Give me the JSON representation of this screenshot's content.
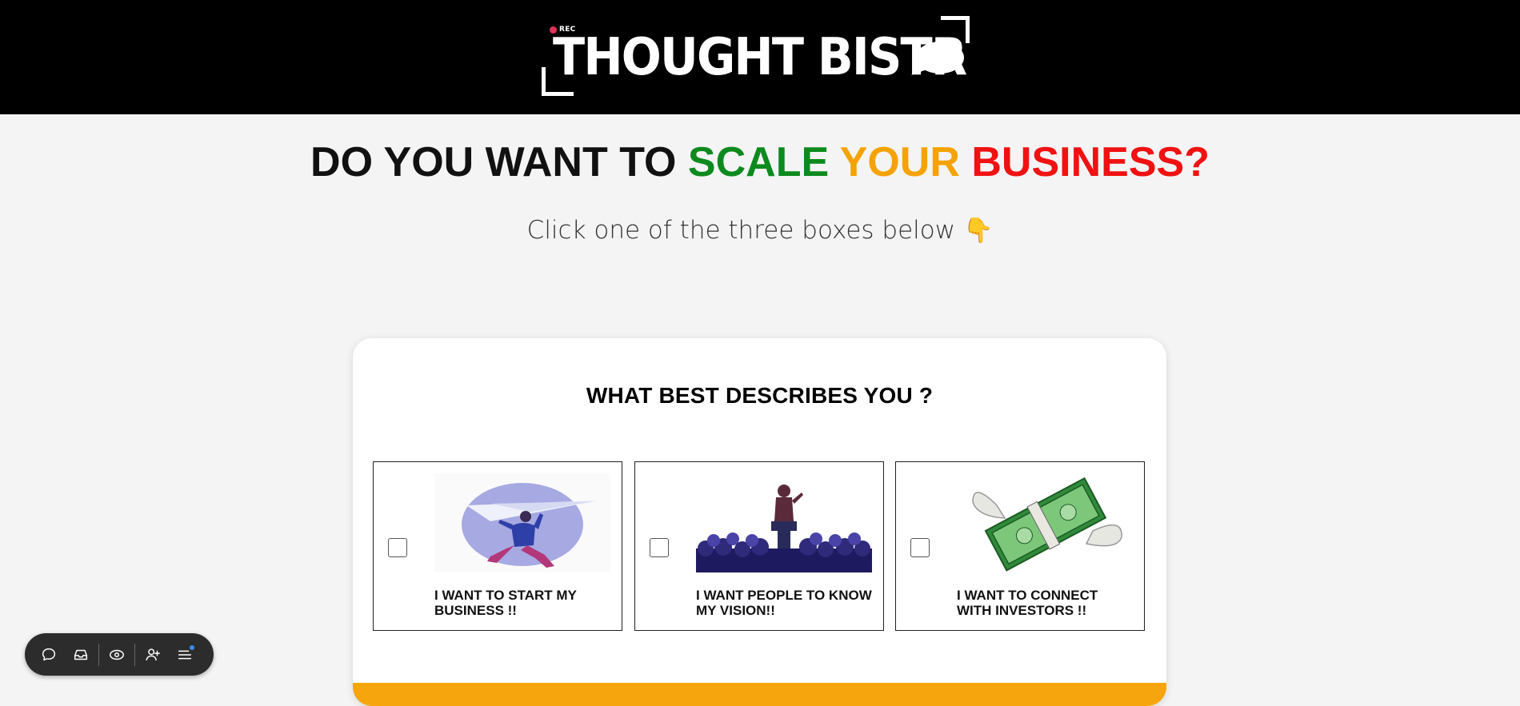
{
  "header": {
    "rec_label": "REC",
    "logo_text": "THOUGHT BISTR"
  },
  "hero": {
    "words": [
      {
        "text": "DO YOU WANT TO ",
        "color": "#111111"
      },
      {
        "text": "SCALE ",
        "color": "#0d8a1e"
      },
      {
        "text": "YOUR ",
        "color": "#f5a300"
      },
      {
        "text": "BUSINESS?",
        "color": "#f01212"
      }
    ],
    "subtitle": "Click one of the three boxes below",
    "subtitle_emoji": "👇"
  },
  "card": {
    "title": "WHAT BEST DESCRIBES YOU ?",
    "options": [
      {
        "label": "I WANT TO START MY BUSINESS !!",
        "icon": "paper-plane-runner-icon",
        "checked": false
      },
      {
        "label": "I WANT PEOPLE TO KNOW MY VISION!!",
        "icon": "speaker-crowd-icon",
        "checked": false
      },
      {
        "label": "I WANT TO CONNECT WITH INVESTORS !!",
        "icon": "flying-money-icon",
        "checked": false
      }
    ]
  },
  "colors": {
    "header_bg": "#000000",
    "page_bg": "#f4f4f4",
    "accent_orange": "#f7a50d"
  },
  "toolbar": {
    "items": [
      "chat-icon",
      "inbox-icon",
      "eye-icon",
      "add-user-icon",
      "menu-icon"
    ]
  }
}
